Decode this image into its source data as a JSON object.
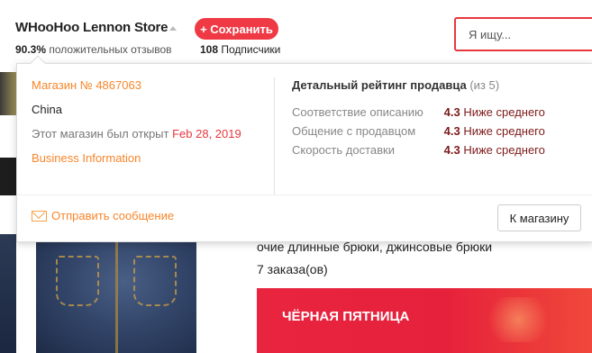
{
  "header": {
    "store_name": "WHooHoo Lennon Store",
    "save_label": "+ Сохранить",
    "feedback_percent": "90.3%",
    "feedback_text": "положительных отзывов",
    "subscribers_count": "108",
    "subscribers_label": "Подписчики",
    "search_placeholder": "Я ищу..."
  },
  "popup": {
    "store_number": "Магазин № 4867063",
    "country": "China",
    "opened_label": "Этот магазин был открыт",
    "opened_date": "Feb 28, 2019",
    "business_info": "Business Information",
    "rating_title": "Детальный рейтинг продавца",
    "rating_scale": "(из 5)",
    "ratings": [
      {
        "label": "Соответствие описанию",
        "score": "4.3",
        "verdict": "Ниже среднего"
      },
      {
        "label": "Общение с продавцом",
        "score": "4.3",
        "verdict": "Ниже среднего"
      },
      {
        "label": "Скорость доставки",
        "score": "4.3",
        "verdict": "Ниже среднего"
      }
    ],
    "send_message": "Отправить сообщение",
    "to_store": "К магазину"
  },
  "product": {
    "title": "очие длинные брюки, джинсовые брюки",
    "orders": "7 заказа(ов)",
    "banner_text": "ЧЁРНАЯ ПЯТНИЦА"
  },
  "colors": {
    "accent": "#e8373e",
    "orange": "#f7862b",
    "rating": "#7d1a1a"
  }
}
